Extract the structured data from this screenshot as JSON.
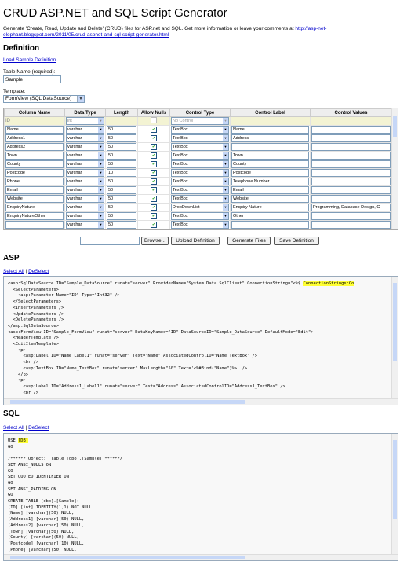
{
  "title": "CRUD ASP.NET and SQL Script Generator",
  "intro": {
    "text": "Generate 'Create, Read, Update and Delete' (CRUD) files for ASP.net and SQL. Get more information or leave your comments at ",
    "link": "http://asp-net-elephant.blogspot.com/2011/05/crud-aspnet-and-sql-script-generator.html"
  },
  "definition": {
    "heading": "Definition",
    "load_sample": "Load Sample Definition",
    "table_name_label": "Table Name (required):",
    "table_name_value": "Sample",
    "template_label": "Template:",
    "template_value": "FormView (SQL DataSource)"
  },
  "grid": {
    "columns": [
      "Column Name",
      "Data Type",
      "Length",
      "Allow Nulls",
      "Control Type",
      "Control Label",
      "Control Values"
    ],
    "id_row": {
      "name": "ID",
      "type": "int",
      "control": "No Control"
    },
    "rows": [
      {
        "name": "Name",
        "type": "varchar",
        "length": "50",
        "nulls": true,
        "control": "TextBox",
        "label": "Name",
        "values": ""
      },
      {
        "name": "Address1",
        "type": "varchar",
        "length": "50",
        "nulls": true,
        "control": "TextBox",
        "label": "Address",
        "values": ""
      },
      {
        "name": "Address2",
        "type": "varchar",
        "length": "50",
        "nulls": true,
        "control": "TextBox",
        "label": "",
        "values": ""
      },
      {
        "name": "Town",
        "type": "varchar",
        "length": "50",
        "nulls": true,
        "control": "TextBox",
        "label": "Town",
        "values": ""
      },
      {
        "name": "County",
        "type": "varchar",
        "length": "50",
        "nulls": true,
        "control": "TextBox",
        "label": "County",
        "values": ""
      },
      {
        "name": "Postcode",
        "type": "varchar",
        "length": "10",
        "nulls": true,
        "control": "TextBox",
        "label": "Postcode",
        "values": ""
      },
      {
        "name": "Phone",
        "type": "varchar",
        "length": "50",
        "nulls": true,
        "control": "TextBox",
        "label": "Telephone Number",
        "values": ""
      },
      {
        "name": "Email",
        "type": "varchar",
        "length": "50",
        "nulls": true,
        "control": "TextBox",
        "label": "Email",
        "values": ""
      },
      {
        "name": "Website",
        "type": "varchar",
        "length": "50",
        "nulls": true,
        "control": "TextBox",
        "label": "Website",
        "values": ""
      },
      {
        "name": "EnquiryNature",
        "type": "varchar",
        "length": "50",
        "nulls": true,
        "control": "DropDownList",
        "label": "Enquiry Nature",
        "values": "Programming, Database Design, C"
      },
      {
        "name": "EnquiryNatureOther",
        "type": "varchar",
        "length": "50",
        "nulls": true,
        "control": "TextBox",
        "label": "Other",
        "values": ""
      },
      {
        "name": "",
        "type": "varchar",
        "length": "50",
        "nulls": true,
        "control": "TextBox",
        "label": "",
        "values": ""
      },
      {
        "name": "",
        "type": "varchar",
        "length": "50",
        "nulls": true,
        "control": "TextBox",
        "label": "",
        "values": ""
      }
    ]
  },
  "buttons": {
    "browse": "Browse...",
    "upload": "Upload Definition",
    "generate": "Generate Files",
    "save": "Save Definition"
  },
  "asp": {
    "heading": "ASP",
    "select_all": "Select All",
    "sep": " | ",
    "deselect": "DeSelect",
    "line1_pre": "<asp:SqlDataSource ID=\"Sample_DataSource\" runat=\"server\" ProviderName=\"System.Data.SqlClient\" ConnectionString=\"<%$ ",
    "line1_hl": "ConnectionStrings:Co",
    "lines": [
      "  <SelectParameters>",
      "    <asp:Parameter Name=\"ID\" Type=\"Int32\" />",
      "  </SelectParameters>",
      "  <InsertParameters />",
      "  <UpdateParameters />",
      "  <DeleteParameters />",
      "</asp:SqlDataSource>",
      "<asp:FormView ID=\"Sample_FormView\" runat=\"server\" DataKeyNames=\"ID\" DataSourceID=\"Sample_DataSource\" DefaultMode=\"Edit\">",
      "  <HeaderTemplate />",
      "  <EditItemTemplate>",
      "    <p>",
      "      <asp:Label ID=\"Name_Label1\" runat=\"server\" Text=\"Name\" AssociatedControlID=\"Name_TextBox\" />",
      "      <br />",
      "      <asp:TextBox ID=\"Name_TextBox\" runat=\"server\" MaxLength=\"50\" Text='<%#Bind(\"Name\")%>' />",
      "    </p>",
      "    <p>",
      "      <asp:Label ID=\"Address1_Label1\" runat=\"server\" Text=\"Address\" AssociatedControlID=\"Address1_TextBox\" />",
      "      <br />"
    ]
  },
  "sql": {
    "heading": "SQL",
    "select_all": "Select All",
    "sep": " | ",
    "deselect": "DeSelect",
    "line1_pre": "USE ",
    "line1_hl": "[DB]",
    "lines": [
      "GO",
      "",
      "/****** Object:  Table [dbo].[Sample] ******/",
      "SET ANSI_NULLS ON",
      "GO",
      "SET QUOTED_IDENTIFIER ON",
      "GO",
      "SET ANSI_PADDING ON",
      "GO",
      "CREATE TABLE [dbo].[Sample](",
      "[ID] [int] IDENTITY(1,1) NOT NULL,",
      "[Name] [varchar](50) NULL,",
      "[Address1] [varchar](50) NULL,",
      "[Address2] [varchar](50) NULL,",
      "[Town] [varchar](50) NULL,",
      "[County] [varchar](50) NULL,",
      "[Postcode] [varchar](10) NULL,",
      "[Phone] [varchar](50) NULL,"
    ]
  }
}
